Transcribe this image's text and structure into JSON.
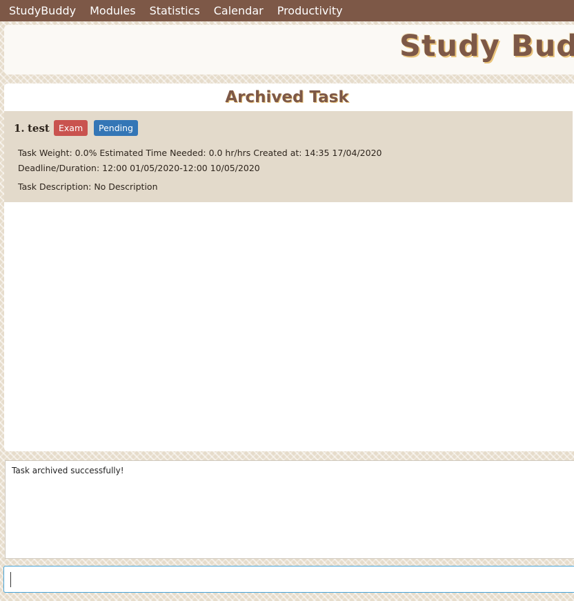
{
  "menu": {
    "items": [
      "StudyBuddy",
      "Modules",
      "Statistics",
      "Calendar",
      "Productivity"
    ]
  },
  "banner": {
    "title": "Study Buddy"
  },
  "list": {
    "header": "Archived Task",
    "tasks": [
      {
        "index": "1.",
        "name": "test",
        "type_tag": "Exam",
        "status_tag": "Pending",
        "line1": "Task Weight: 0.0%   Estimated Time Needed: 0.0 hr/hrs   Created at: 14:35 17/04/2020",
        "line2": "Deadline/Duration: 12:00 01/05/2020-12:00 10/05/2020",
        "line3": "Task Description: No Description"
      }
    ]
  },
  "result": {
    "text": "Task archived successfully!"
  },
  "command": {
    "value": "",
    "placeholder": ""
  },
  "colors": {
    "menubar": "#7d5847",
    "title": "#7d5847",
    "title_shadow": "#e9c37a",
    "card": "#e3dacb",
    "tag_exam": "#c9534f",
    "tag_status": "#3476b6",
    "command_border": "#45a3d8"
  }
}
